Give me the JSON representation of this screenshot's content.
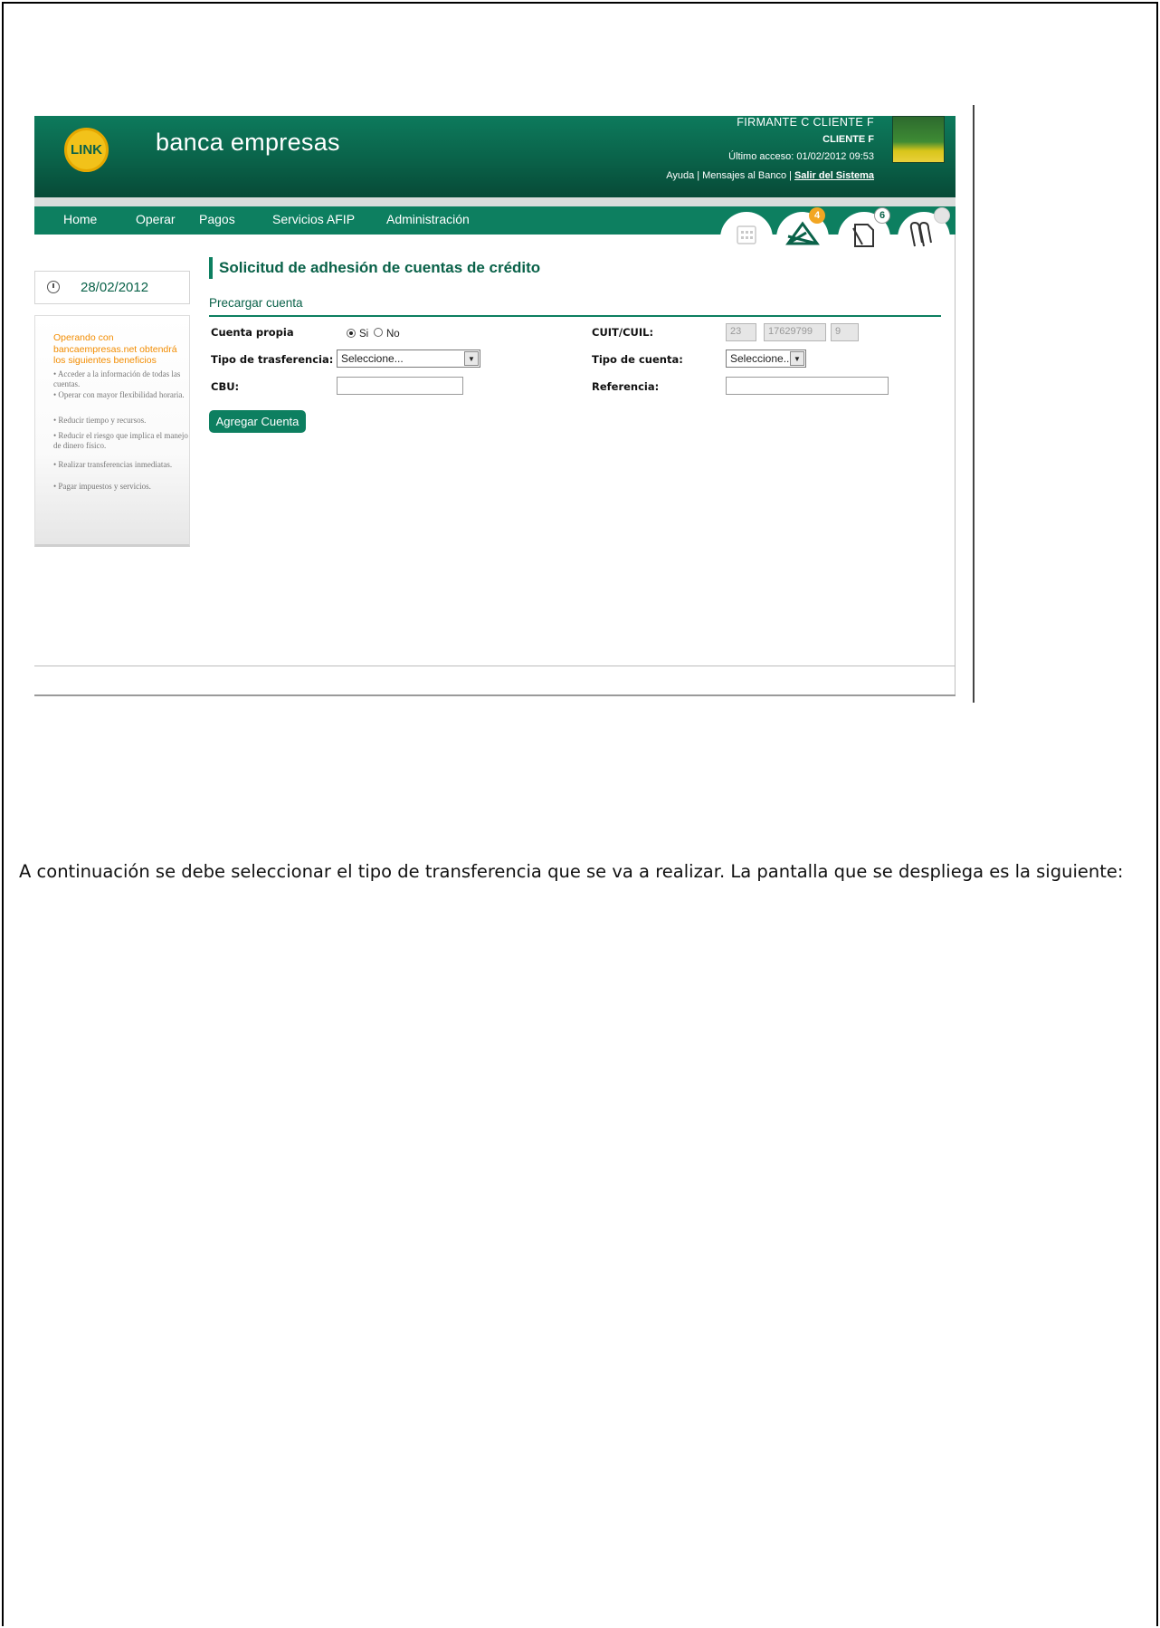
{
  "app": {
    "brand": "banca empresas",
    "logo_text": "LINK",
    "user_name": "FIRMANTE C CLIENTE F",
    "client_name": "CLIENTE F",
    "last_access": "Último acceso: 01/02/2012 09:53",
    "links": {
      "help": "Ayuda",
      "separator": "|",
      "messages": "Mensajes al Banco",
      "logout": "Salir del Sistema"
    }
  },
  "nav": {
    "items": [
      "Home",
      "Operar",
      "Pagos",
      "Servicios AFIP",
      "Administración"
    ],
    "icons": [
      {
        "name": "calendar-icon",
        "badge": ""
      },
      {
        "name": "envelope-icon",
        "badge": "4"
      },
      {
        "name": "document-icon",
        "badge": "6"
      },
      {
        "name": "clip-icon",
        "badge": ""
      }
    ]
  },
  "sidebar": {
    "date": "28/02/2012",
    "benefits_title": "Operando con bancaempresas.net obtendrá los siguientes beneficios",
    "benefits": [
      "Acceder a la información de todas las cuentas.",
      "Operar con mayor flexibilidad horaria.",
      "Reducir tiempo y recursos.",
      "Reducir el riesgo que implica el manejo de dinero físico.",
      "Realizar transferencias inmediatas.",
      "Pagar impuestos y servicios."
    ]
  },
  "form": {
    "title": "Solicitud de adhesión de cuentas de crédito",
    "subtitle": "Precargar cuenta",
    "own_account_label": "Cuenta propia",
    "own_account_yes": "Si",
    "own_account_no": "No",
    "cuit_label": "CUIT/CUIL:",
    "cuit_part1": "23",
    "cuit_part2": "17629799",
    "cuit_part3": "9",
    "transfer_type_label": "Tipo de trasferencia:",
    "transfer_type_value": "Seleccione...",
    "account_type_label": "Tipo de cuenta:",
    "account_type_value": "Seleccione...",
    "cbu_label": "CBU:",
    "cbu_value": "",
    "reference_label": "Referencia:",
    "reference_value": "",
    "add_button": "Agregar Cuenta"
  },
  "document": {
    "paragraph": "A continuación se debe seleccionar el tipo de transferencia que se va a realizar. La pantalla que se despliega es la siguiente:"
  },
  "colors": {
    "primary": "#0d7f60",
    "dark": "#074a37",
    "accent": "#f28c00"
  }
}
